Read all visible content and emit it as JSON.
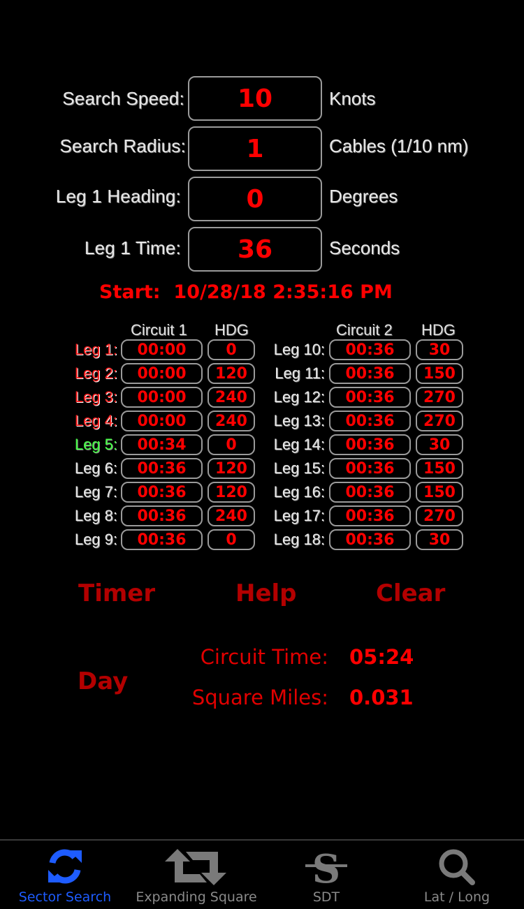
{
  "inputs": [
    {
      "label": "Search Speed:",
      "value": "10",
      "unit": "Knots"
    },
    {
      "label": "Search Radius:",
      "value": "1",
      "unit": "Cables (1/10 nm)"
    },
    {
      "label": "Leg 1 Heading:",
      "value": "0",
      "unit": "Degrees"
    },
    {
      "label": "Leg 1 Time:",
      "value": "36",
      "unit": "Seconds"
    }
  ],
  "start": {
    "label": "Start:",
    "value": "10/28/18 2:35:16 PM"
  },
  "circuits": [
    {
      "header": "Circuit 1",
      "hdg_header": "HDG",
      "legs": [
        {
          "label": "Leg 1:",
          "time": "00:00",
          "hdg": "0",
          "state": "done"
        },
        {
          "label": "Leg 2:",
          "time": "00:00",
          "hdg": "120",
          "state": "done"
        },
        {
          "label": "Leg 3:",
          "time": "00:00",
          "hdg": "240",
          "state": "done"
        },
        {
          "label": "Leg 4:",
          "time": "00:00",
          "hdg": "240",
          "state": "done"
        },
        {
          "label": "Leg 5:",
          "time": "00:34",
          "hdg": "0",
          "state": "active"
        },
        {
          "label": "Leg 6:",
          "time": "00:36",
          "hdg": "120",
          "state": "pending"
        },
        {
          "label": "Leg 7:",
          "time": "00:36",
          "hdg": "120",
          "state": "pending"
        },
        {
          "label": "Leg 8:",
          "time": "00:36",
          "hdg": "240",
          "state": "pending"
        },
        {
          "label": "Leg 9:",
          "time": "00:36",
          "hdg": "0",
          "state": "pending"
        }
      ]
    },
    {
      "header": "Circuit 2",
      "hdg_header": "HDG",
      "legs": [
        {
          "label": "Leg 10:",
          "time": "00:36",
          "hdg": "30",
          "state": "pending"
        },
        {
          "label": "Leg 11:",
          "time": "00:36",
          "hdg": "150",
          "state": "pending"
        },
        {
          "label": "Leg 12:",
          "time": "00:36",
          "hdg": "270",
          "state": "pending"
        },
        {
          "label": "Leg 13:",
          "time": "00:36",
          "hdg": "270",
          "state": "pending"
        },
        {
          "label": "Leg 14:",
          "time": "00:36",
          "hdg": "30",
          "state": "pending"
        },
        {
          "label": "Leg 15:",
          "time": "00:36",
          "hdg": "150",
          "state": "pending"
        },
        {
          "label": "Leg 16:",
          "time": "00:36",
          "hdg": "150",
          "state": "pending"
        },
        {
          "label": "Leg 17:",
          "time": "00:36",
          "hdg": "270",
          "state": "pending"
        },
        {
          "label": "Leg 18:",
          "time": "00:36",
          "hdg": "30",
          "state": "pending"
        }
      ]
    }
  ],
  "buttons": {
    "timer": "Timer",
    "help": "Help",
    "clear": "Clear",
    "day": "Day"
  },
  "stats": {
    "circuit_time_label": "Circuit Time:",
    "circuit_time": "05:24",
    "square_miles_label": "Square Miles:",
    "square_miles": "0.031"
  },
  "tabs": [
    {
      "label": "Sector Search",
      "icon": "refresh-icon",
      "active": true
    },
    {
      "label": "Expanding Square",
      "icon": "retweet-icon",
      "active": false
    },
    {
      "label": "SDT",
      "icon": "strikethrough-s-icon",
      "active": false
    },
    {
      "label": "Lat / Long",
      "icon": "search-icon",
      "active": false
    }
  ],
  "colors": {
    "accent_red": "#ff0000",
    "button_red": "#b30000",
    "active_green": "#44ff44",
    "tab_active": "#1e5cff",
    "tab_inactive": "#8a8a8a"
  }
}
